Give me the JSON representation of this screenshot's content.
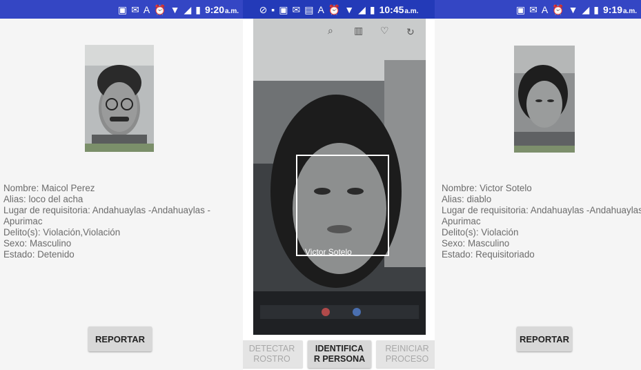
{
  "left_panel": {
    "status": {
      "time": "9:20",
      "ampm": "a.m."
    },
    "info": [
      "Nombre: Maicol Perez",
      "Alias: loco del acha",
      "Lugar de requisitoria: Andahuaylas -Andahuaylas -",
      "Apurimac",
      "Delito(s): Violación,Violación",
      "Sexo: Masculino",
      "Estado: Detenido"
    ],
    "report_button": "REPORTAR"
  },
  "middle_panel": {
    "status": {
      "time": "10:45",
      "ampm": "a.m."
    },
    "face_label": "Victor Sotelo",
    "buttons": {
      "detect": [
        "DETECTAR",
        "ROSTRO"
      ],
      "identify": [
        "IDENTIFICA",
        "R PERSONA"
      ],
      "restart": [
        "REINICIAR",
        "PROCESO"
      ]
    }
  },
  "right_panel": {
    "status": {
      "time": "9:19",
      "ampm": "a.m."
    },
    "info": [
      "Nombre: Victor Sotelo",
      "Alias: diablo",
      "Lugar de requisitoria: Andahuaylas -Andahuaylas -",
      "Apurimac",
      "Delito(s): Violación",
      "Sexo: Masculino",
      "Estado: Requisitoriado"
    ],
    "report_button": "REPORTAR"
  },
  "icons": {
    "status_icons": [
      "gallery-icon",
      "mail-icon",
      "a-icon",
      "alarm-icon",
      "wifi-icon",
      "signal-icon",
      "battery-icon"
    ],
    "camera_toolbar": [
      "zoom-icon",
      "trash-icon",
      "heart-icon",
      "rotate-icon"
    ]
  },
  "colors": {
    "status_bar": "#3446c4",
    "info_text": "#6b6b6b",
    "button_bg": "#d8d8d8"
  }
}
